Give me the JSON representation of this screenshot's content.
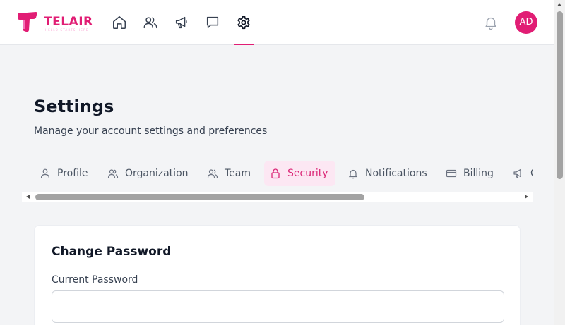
{
  "brand": {
    "name": "TELAIR",
    "tagline": "HELLO STARTS HERE",
    "accent_color": "#e11d74"
  },
  "topnav": {
    "icons": [
      "home-icon",
      "users-icon",
      "megaphone-icon",
      "chat-icon",
      "gear-icon"
    ],
    "active": "gear-icon"
  },
  "user": {
    "initials": "AD"
  },
  "page": {
    "title": "Settings",
    "subtitle": "Manage your account settings and preferences"
  },
  "tabs": [
    {
      "label": "Profile",
      "icon": "user-icon"
    },
    {
      "label": "Organization",
      "icon": "users-icon"
    },
    {
      "label": "Team",
      "icon": "users-icon"
    },
    {
      "label": "Security",
      "icon": "lock-icon",
      "active": true
    },
    {
      "label": "Notifications",
      "icon": "bell-icon"
    },
    {
      "label": "Billing",
      "icon": "credit-card-icon"
    },
    {
      "label": "C",
      "icon": "megaphone-icon"
    }
  ],
  "change_password": {
    "title": "Change Password",
    "current_label": "Current Password",
    "current_value": "",
    "current_placeholder": ""
  }
}
